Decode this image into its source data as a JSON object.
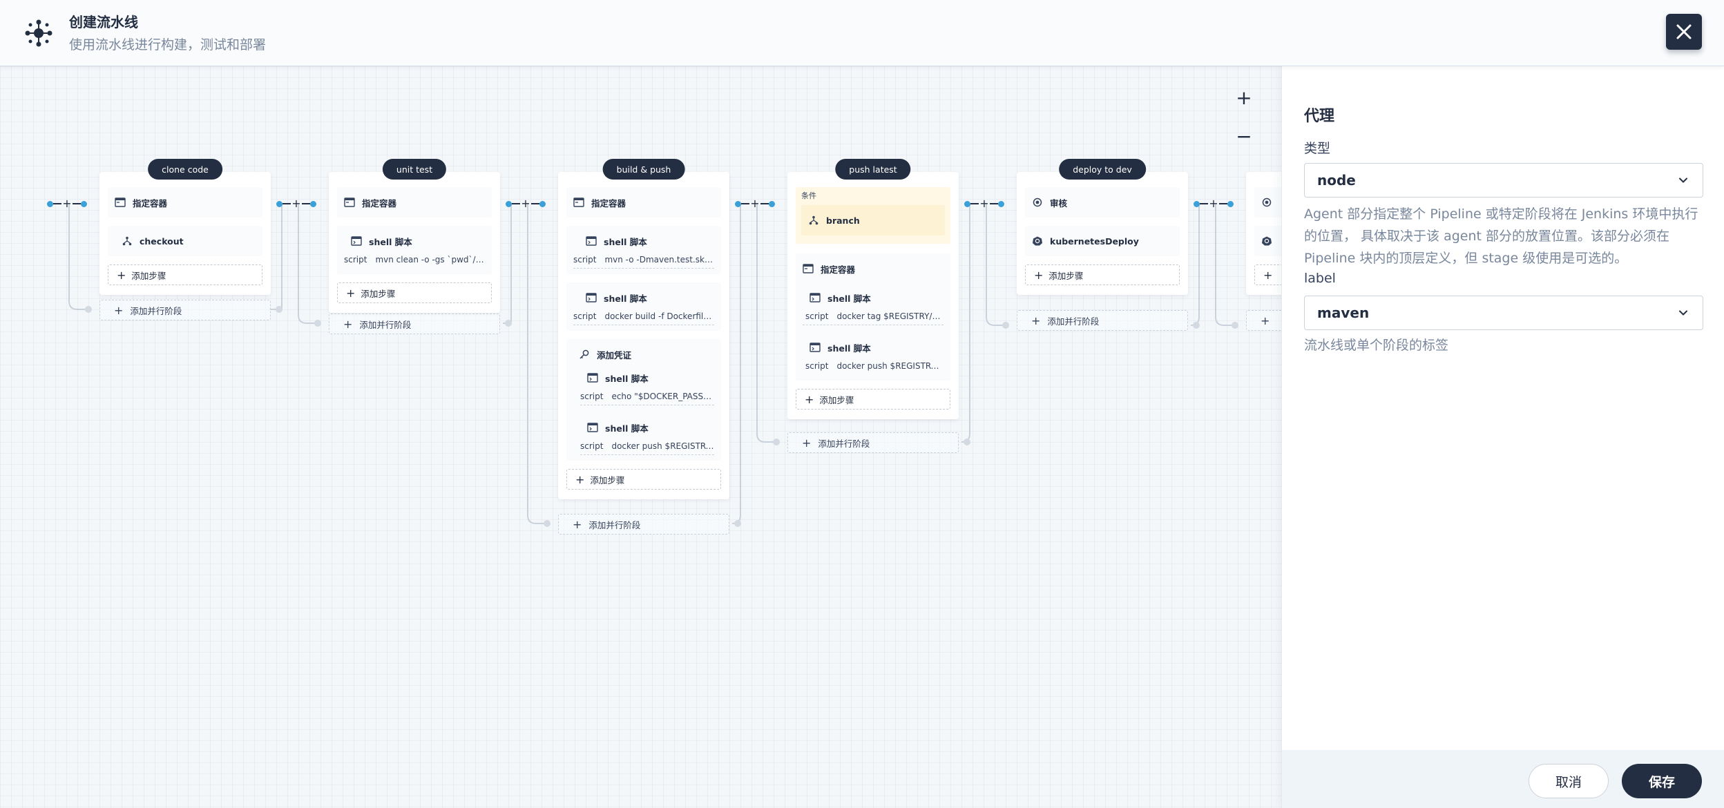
{
  "header": {
    "title": "创建流水线",
    "subtitle": "使用流水线进行构建，测试和部署"
  },
  "canvas": {
    "zoom_in": "+",
    "zoom_out": "−"
  },
  "stages": [
    {
      "name": "clone code",
      "steps": [
        {
          "icon": "container-icon",
          "title": "指定容器"
        },
        {
          "icon": "branch-icon",
          "title": "checkout",
          "nested": true
        }
      ],
      "add_step": "添加步骤",
      "add_parallel": "添加并行阶段"
    },
    {
      "name": "unit test",
      "steps": [
        {
          "icon": "container-icon",
          "title": "指定容器"
        },
        {
          "icon": "shell-icon",
          "title": "shell 脚本",
          "nested": true,
          "script_key": "script",
          "script": "mvn clean -o -gs `pwd`/configuration/settings.xml test"
        }
      ],
      "add_step": "添加步骤",
      "add_parallel": "添加并行阶段"
    },
    {
      "name": "build & push",
      "steps": [
        {
          "icon": "container-icon",
          "title": "指定容器"
        },
        {
          "icon": "shell-icon",
          "title": "shell 脚本",
          "nested": true,
          "script_key": "script",
          "script": "mvn -o -Dmaven.test.skip=true"
        },
        {
          "icon": "shell-icon",
          "title": "shell 脚本",
          "nested": true,
          "script_key": "script",
          "script": "docker build -f Dockerfile-online"
        },
        {
          "icon": "key-icon",
          "title": "添加凭证",
          "nested": true
        },
        {
          "icon": "shell-icon",
          "title": "shell 脚本",
          "nested": true,
          "script_key": "script",
          "script": "echo \"$DOCKER_PASSWORD\""
        },
        {
          "icon": "shell-icon",
          "title": "shell 脚本",
          "nested": true,
          "script_key": "script",
          "script": "docker push $REGISTRY/$DOCKERHUB"
        }
      ],
      "add_step": "添加步骤",
      "add_parallel": "添加并行阶段"
    },
    {
      "name": "push latest",
      "condition_label": "条件",
      "condition": "branch",
      "steps": [
        {
          "icon": "container-icon",
          "title": "指定容器"
        },
        {
          "icon": "shell-icon",
          "title": "shell 脚本",
          "nested": true,
          "script_key": "script",
          "script": "docker tag $REGISTRY/$DOCKERHUB"
        },
        {
          "icon": "shell-icon",
          "title": "shell 脚本",
          "nested": true,
          "script_key": "script",
          "script": "docker push $REGISTRY/$DOCKERHUB"
        }
      ],
      "add_step": "添加步骤",
      "add_parallel": "添加并行阶段"
    },
    {
      "name": "deploy to dev",
      "steps": [
        {
          "icon": "review-icon",
          "title": "审核"
        },
        {
          "icon": "kubernetes-icon",
          "title": "kubernetesDeploy"
        }
      ],
      "add_step": "添加步骤",
      "add_parallel": "添加并行阶段"
    },
    {
      "name": "",
      "partial": true,
      "steps": [
        {
          "icon": "review-icon",
          "title": ""
        },
        {
          "icon": "kubernetes-icon",
          "title": ""
        }
      ],
      "add_step": "",
      "add_parallel": ""
    }
  ],
  "panel": {
    "title": "代理",
    "type_label": "类型",
    "type_value": "node",
    "type_desc": "Agent 部分指定整个 Pipeline 或特定阶段将在 Jenkins 环境中执行的位置， 具体取决于该 agent 部分的放置位置。该部分必须在 Pipeline 块内的顶层定义，但 stage 级使用是可选的。",
    "label_label": "label",
    "label_value": "maven",
    "label_desc": "流水线或单个阶段的标签",
    "cancel": "取消",
    "save": "保存"
  },
  "colors": {
    "primary_dark": "#242e42",
    "accent_blue": "#3ba0d8",
    "condition_bg": "#fff8e5",
    "muted_text": "#79879c"
  }
}
